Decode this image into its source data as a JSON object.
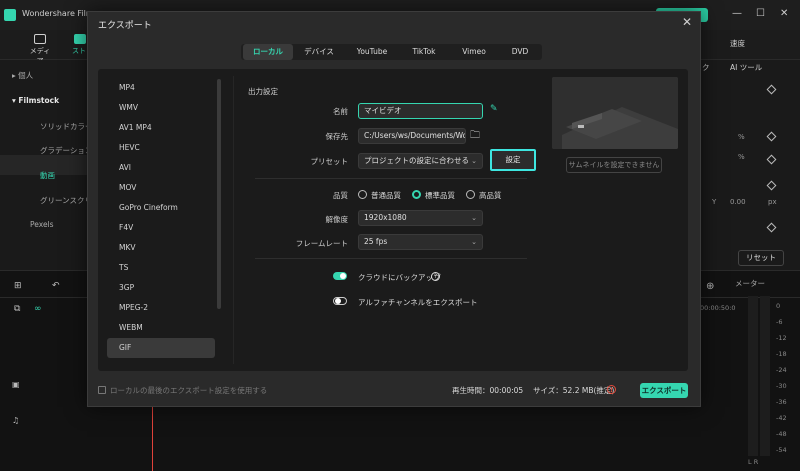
{
  "app": {
    "title": "Wondershare Filmo"
  },
  "app_tabs": {
    "media": "メディア",
    "stock": "スト"
  },
  "left_panel": {
    "items": [
      "個人",
      "Filmstock",
      "ソリッドカラー",
      "グラデーション",
      "動画",
      "グリーンスクリー",
      "Pexels"
    ]
  },
  "right_panel": {
    "tab_speed": "速度",
    "tab_k": "ク",
    "tab_ai": "AI ツール",
    "reset": "リセット",
    "y_label": "Y",
    "y_value": "0.00",
    "px": "px",
    "pct1": "%",
    "pct2": "%"
  },
  "meter": {
    "label": "メーター",
    "db": [
      "0",
      "-6",
      "-12",
      "-18",
      "-24",
      "-30",
      "-36",
      "-42",
      "-48",
      "-54"
    ],
    "lr": "L   R"
  },
  "timeline": {
    "time": "00:00:50:0"
  },
  "dialog": {
    "title": "エクスポート",
    "tabs": [
      "ローカル",
      "デバイス",
      "YouTube",
      "TikTok",
      "Vimeo",
      "DVD"
    ],
    "formats": [
      "MP4",
      "WMV",
      "AV1 MP4",
      "HEVC",
      "AVI",
      "MOV",
      "GoPro Cineform",
      "F4V",
      "MKV",
      "TS",
      "3GP",
      "MPEG-2",
      "WEBM",
      "GIF"
    ],
    "selected_format": "GIF",
    "output_section": "出力設定",
    "name_label": "名前",
    "name_value": "マイビデオ",
    "save_label": "保存先",
    "save_value": "C:/Users/ws/Documents/Won",
    "preset_label": "プリセット",
    "preset_value": "プロジェクトの設定に合わせる",
    "settings_button": "設定",
    "quality_label": "品質",
    "quality_options": [
      "普通品質",
      "標準品質",
      "高品質"
    ],
    "quality_selected": 1,
    "resolution_label": "解像度",
    "resolution_value": "1920x1080",
    "framerate_label": "フレームレート",
    "framerate_value": "25 fps",
    "cloud_backup_label": "クラウドにバックアップ",
    "cloud_backup_on": true,
    "alpha_label": "アルファチャンネルをエクスポート",
    "alpha_on": false,
    "thumbnail_button": "サムネイルを設定できません",
    "footer_note": "ローカルの最後のエクスポート設定を使用する",
    "duration_label": "再生時間：00:00:05",
    "size_label": "サイズ：52.2 MB(推定)",
    "export_button": "エクスポート"
  },
  "colors": {
    "accent": "#35d6b0",
    "highlight": "#3ee6e0",
    "warning": "#e24b3b"
  }
}
